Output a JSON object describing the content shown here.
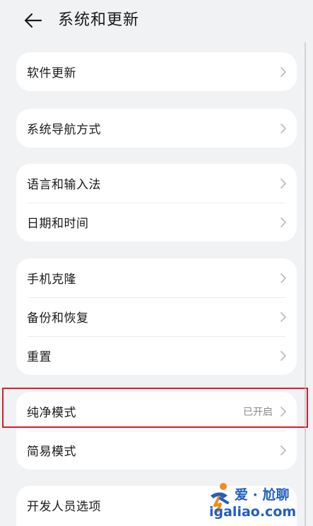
{
  "header": {
    "title": "系统和更新"
  },
  "cards": [
    {
      "items": [
        {
          "label": "软件更新",
          "value": ""
        }
      ]
    },
    {
      "items": [
        {
          "label": "系统导航方式",
          "value": ""
        }
      ]
    },
    {
      "items": [
        {
          "label": "语言和输入法",
          "value": ""
        },
        {
          "label": "日期和时间",
          "value": ""
        }
      ]
    },
    {
      "items": [
        {
          "label": "手机克隆",
          "value": ""
        },
        {
          "label": "备份和恢复",
          "value": ""
        },
        {
          "label": "重置",
          "value": ""
        }
      ]
    },
    {
      "items": [
        {
          "label": "纯净模式",
          "value": "已开启"
        },
        {
          "label": "简易模式",
          "value": ""
        }
      ]
    },
    {
      "items": [
        {
          "label": "开发人员选项",
          "value": ""
        }
      ]
    }
  ],
  "watermark": {
    "title": "爱 · 尬聊",
    "url": "igaliao.com"
  },
  "colors": {
    "background": "#f1f2f4",
    "card": "#ffffff",
    "highlight": "#e0192b",
    "watermark": "#1f5fbf"
  },
  "icons": {
    "back": "arrow-left-icon",
    "row_chevron": "chevron-right-icon",
    "watermark_logo": "runner-logo-icon"
  }
}
